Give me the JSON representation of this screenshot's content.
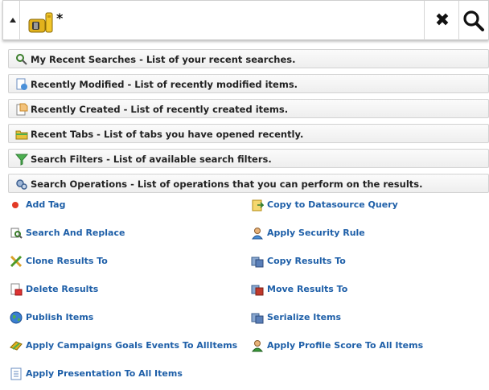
{
  "search": {
    "query": "*",
    "icons": {
      "toggle": "expand-arrow-icon",
      "database": "database-icon",
      "clear": "close-icon",
      "search": "search-icon"
    }
  },
  "sections": [
    {
      "id": "recent-searches",
      "label": "My Recent Searches - List of your recent searches.",
      "icon": "recent-searches-icon"
    },
    {
      "id": "recently-modified",
      "label": "Recently Modified - List of recently modified items.",
      "icon": "document-edit-icon"
    },
    {
      "id": "recently-created",
      "label": "Recently Created - List of recently created items.",
      "icon": "document-new-icon"
    },
    {
      "id": "recent-tabs",
      "label": "Recent Tabs - List of tabs you have opened recently.",
      "icon": "folder-icon"
    },
    {
      "id": "search-filters",
      "label": "Search Filters - List of available search filters.",
      "icon": "funnel-icon"
    },
    {
      "id": "search-operations",
      "label": "Search Operations - List of operations that you can perform on the results.",
      "icon": "gears-icon"
    }
  ],
  "operations": {
    "left": [
      {
        "label": "Add Tag",
        "icon": "tag-dot-icon"
      },
      {
        "label": "Search And Replace",
        "icon": "search-replace-icon"
      },
      {
        "label": "Clone Results To",
        "icon": "clone-icon"
      },
      {
        "label": "Delete Results",
        "icon": "delete-icon"
      },
      {
        "label": "Publish Items",
        "icon": "globe-icon"
      },
      {
        "label": "Apply Campaigns Goals Events To AllItems",
        "icon": "campaign-icon"
      },
      {
        "label": "Apply Presentation To All Items",
        "icon": "presentation-icon"
      }
    ],
    "right": [
      {
        "label": "Copy to Datasource Query",
        "icon": "datasource-icon"
      },
      {
        "label": "Apply Security Rule",
        "icon": "security-user-icon"
      },
      {
        "label": "Copy Results To",
        "icon": "copy-results-icon"
      },
      {
        "label": "Move Results To",
        "icon": "move-results-icon"
      },
      {
        "label": "Serialize Items",
        "icon": "serialize-icon"
      },
      {
        "label": "Apply Profile Score To All Items",
        "icon": "profile-score-icon"
      }
    ]
  },
  "colors": {
    "link": "#1e5fa8",
    "add_tag_dot": "#e23a26"
  }
}
